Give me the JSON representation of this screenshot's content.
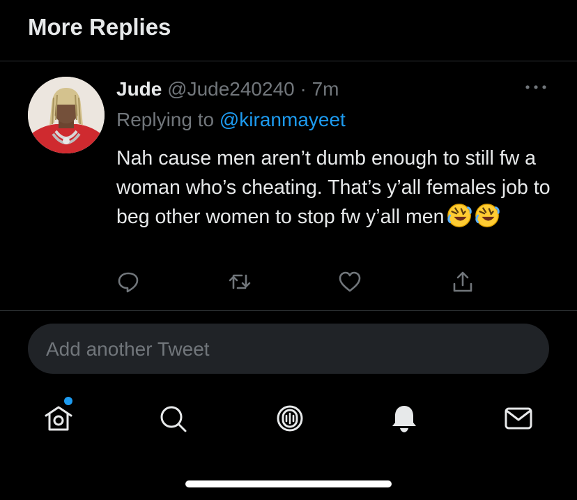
{
  "header": {
    "title": "More Replies"
  },
  "tweet": {
    "author_name": "Jude",
    "handle": "@Jude240240",
    "separator": "·",
    "time": "7m",
    "replying_prefix": "Replying to",
    "replying_to": "@kiranmayeet",
    "text": "Nah cause men aren’t dumb enough to still fw a woman who’s cheating. That’s y’all females job to beg other women to stop fw y’all men",
    "emojis": [
      "rolling-on-floor-laughing-emoji",
      "rolling-on-floor-laughing-emoji"
    ],
    "actions": [
      "reply-icon",
      "retweet-icon",
      "like-icon",
      "share-icon"
    ]
  },
  "compose": {
    "placeholder": "Add another Tweet"
  },
  "bottom_nav": {
    "items": [
      "home-icon",
      "search-icon",
      "spaces-icon",
      "notifications-icon",
      "messages-icon"
    ],
    "home_has_notification": true
  },
  "colors": {
    "background": "#000000",
    "text_primary": "#e7e9ea",
    "text_secondary": "#71767b",
    "accent": "#1d9bf0",
    "divider": "#2f3336",
    "input_bg": "#202327"
  }
}
